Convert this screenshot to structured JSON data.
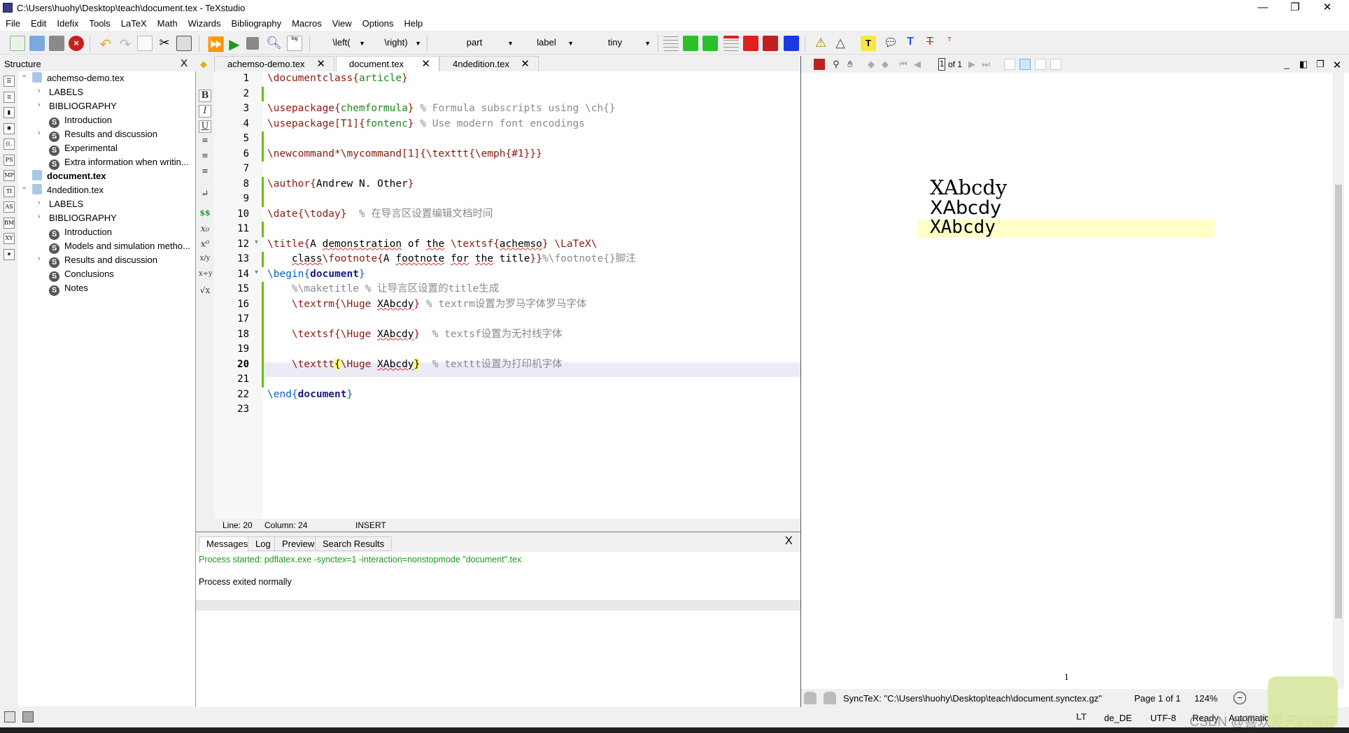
{
  "window": {
    "title": "C:\\Users\\huohy\\Desktop\\teach\\document.tex - TeXstudio",
    "minimize": "—",
    "restore": "❐",
    "close": "✕"
  },
  "menu": [
    "File",
    "Edit",
    "Idefix",
    "Tools",
    "LaTeX",
    "Math",
    "Wizards",
    "Bibliography",
    "Macros",
    "View",
    "Options",
    "Help"
  ],
  "toolbar": {
    "left_combo": "\\left(",
    "right_combo": "\\right)",
    "section_combo": "part",
    "ref_combo": "label",
    "size_combo": "tiny"
  },
  "structure": {
    "title": "Structure",
    "close": "X",
    "items": [
      {
        "label": "achemso-demo.tex",
        "type": "file",
        "level": 0,
        "expander": "open"
      },
      {
        "label": "LABELS",
        "type": "group",
        "level": 1,
        "expander": "closed"
      },
      {
        "label": "BIBLIOGRAPHY",
        "type": "group",
        "level": 1,
        "expander": "closed"
      },
      {
        "label": "Introduction",
        "type": "section",
        "level": 1,
        "expander": ""
      },
      {
        "label": "Results and discussion",
        "type": "section",
        "level": 1,
        "expander": "closed"
      },
      {
        "label": "Experimental",
        "type": "section",
        "level": 1,
        "expander": ""
      },
      {
        "label": "Extra information when writin...",
        "type": "section",
        "level": 1,
        "expander": ""
      },
      {
        "label": "document.tex",
        "type": "file",
        "level": 0,
        "expander": "",
        "bold": true
      },
      {
        "label": "4ndedition.tex",
        "type": "file",
        "level": 0,
        "expander": "open"
      },
      {
        "label": "LABELS",
        "type": "group",
        "level": 1,
        "expander": "closed"
      },
      {
        "label": "BIBLIOGRAPHY",
        "type": "group",
        "level": 1,
        "expander": "closed"
      },
      {
        "label": "Introduction",
        "type": "section",
        "level": 1,
        "expander": ""
      },
      {
        "label": "Models and simulation metho...",
        "type": "section",
        "level": 1,
        "expander": ""
      },
      {
        "label": "Results and discussion",
        "type": "section",
        "level": 1,
        "expander": "closed"
      },
      {
        "label": "Conclusions",
        "type": "section",
        "level": 1,
        "expander": ""
      },
      {
        "label": "Notes",
        "type": "section",
        "level": 1,
        "expander": ""
      }
    ],
    "side_icons": [
      "☰",
      "≣",
      "▮",
      "✱",
      "((.",
      "PS",
      "MP",
      "TI",
      "AS",
      "BM",
      "XY",
      "✷"
    ]
  },
  "tabs": [
    {
      "label": "achemso-demo.tex",
      "active": false
    },
    {
      "label": "document.tex",
      "active": true
    },
    {
      "label": "4ndedition.tex",
      "active": false
    }
  ],
  "editor": {
    "current_line": 20,
    "lines": [
      [
        [
          "\\documentclass",
          "cmd"
        ],
        [
          "{",
          "cmd"
        ],
        [
          "article",
          "arg"
        ],
        [
          "}",
          "cmd"
        ]
      ],
      [],
      [
        [
          "\\usepackage",
          "cmd"
        ],
        [
          "{",
          "cmd"
        ],
        [
          "chemformula",
          "arg"
        ],
        [
          "}",
          "cmd"
        ],
        [
          " % Formula subscripts using \\ch{}",
          "cm"
        ]
      ],
      [
        [
          "\\usepackage",
          "cmd"
        ],
        [
          "[T1]",
          "cmd"
        ],
        [
          "{",
          "cmd"
        ],
        [
          "fontenc",
          "arg"
        ],
        [
          "}",
          "cmd"
        ],
        [
          " % Use modern font encodings",
          "cm"
        ]
      ],
      [],
      [
        [
          "\\newcommand*\\mycommand[1]{\\texttt{\\emph{#1}}}",
          "cmd"
        ]
      ],
      [],
      [
        [
          "\\author",
          "cmd"
        ],
        [
          "{",
          "cmd"
        ],
        [
          "Andrew N. Other",
          "txt"
        ],
        [
          "}",
          "cmd"
        ]
      ],
      [],
      [
        [
          "\\date",
          "cmd"
        ],
        [
          "{\\today}",
          "cmd"
        ],
        [
          "  % 在导言区设置编辑文档时间",
          "cm"
        ]
      ],
      [],
      [
        [
          "\\title",
          "cmd"
        ],
        [
          "{",
          "cmd"
        ],
        [
          "A ",
          "txt"
        ],
        [
          "demonstration",
          "sq"
        ],
        [
          " of ",
          "txt"
        ],
        [
          "the",
          "sq"
        ],
        [
          " \\textsf",
          "cmd"
        ],
        [
          "{",
          "cmd"
        ],
        [
          "achemso",
          "sq"
        ],
        [
          "}",
          "cmd"
        ],
        [
          " \\LaTeX\\",
          "cmd"
        ]
      ],
      [
        [
          "    ",
          "txt"
        ],
        [
          "class",
          "sq"
        ],
        [
          "\\footnote",
          "cmd"
        ],
        [
          "{",
          "cmd"
        ],
        [
          "A ",
          "txt"
        ],
        [
          "footnote",
          "sq"
        ],
        [
          " ",
          "txt"
        ],
        [
          "for",
          "sq"
        ],
        [
          " ",
          "txt"
        ],
        [
          "the",
          "sq"
        ],
        [
          " title",
          "txt"
        ],
        [
          "}}",
          "cmd"
        ],
        [
          "%\\footnote{}脚注",
          "cm"
        ]
      ],
      [
        [
          "\\begin",
          "kw"
        ],
        [
          "{",
          "kw"
        ],
        [
          "document",
          "kwa"
        ],
        [
          "}",
          "kw"
        ]
      ],
      [
        [
          "    %\\maketitle % 让导言区设置的title生成",
          "cm"
        ]
      ],
      [
        [
          "    \\textrm",
          "cmd"
        ],
        [
          "{\\Huge ",
          "cmd"
        ],
        [
          "XAbcdy",
          "sq"
        ],
        [
          "}",
          "cmd"
        ],
        [
          " % textrm设置为罗马字体罗马字体",
          "cm"
        ]
      ],
      [],
      [
        [
          "    \\textsf",
          "cmd"
        ],
        [
          "{\\Huge ",
          "cmd"
        ],
        [
          "XAbcdy",
          "sq"
        ],
        [
          "}",
          "cmd"
        ],
        [
          "  % textsf设置为无衬线字体",
          "cm"
        ]
      ],
      [],
      [
        [
          "    \\texttt",
          "cmd"
        ],
        [
          "{",
          "br"
        ],
        [
          "\\Huge ",
          "cmd"
        ],
        [
          "XAbcdy",
          "sq"
        ],
        [
          "}",
          "br"
        ],
        [
          "  % texttt设置为打印机字体",
          "cm"
        ]
      ],
      [],
      [
        [
          "\\end",
          "kw"
        ],
        [
          "{",
          "kw"
        ],
        [
          "document",
          "kwa"
        ],
        [
          "}",
          "kw"
        ]
      ],
      []
    ]
  },
  "editor_status": {
    "line": "Line: 20",
    "column": "Column: 24",
    "mode": "INSERT"
  },
  "messages": {
    "tabs": [
      "Messages",
      "Log",
      "Preview",
      "Search Results"
    ],
    "active": "Messages",
    "close": "X",
    "lines": [
      {
        "text": "Process started: pdflatex.exe -synctex=1 -interaction=nonstopmode \"document\".tex",
        "color": "#1a9a1a"
      },
      {
        "text": "Process exited normally",
        "color": "#000000"
      }
    ]
  },
  "pdf": {
    "page_input": "1",
    "page_of": "of 1",
    "rendered_lines": [
      "XAbcdy",
      "XAbcdy",
      "XAbcdy"
    ],
    "highlight_color": "#ffffc8",
    "page_number": "1",
    "synctex": "SyncTeX: \"C:\\Users\\huohy\\Desktop\\teach\\document.synctex.gz\"",
    "page_status": "Page 1 of 1",
    "zoom": "124%"
  },
  "statusbar": {
    "lt": "LT",
    "language": "de_DE",
    "encoding": "UTF-8",
    "status": "Ready",
    "mode": "Automatic"
  },
  "watermark": "CSDN @喜欢夏天的海洋"
}
